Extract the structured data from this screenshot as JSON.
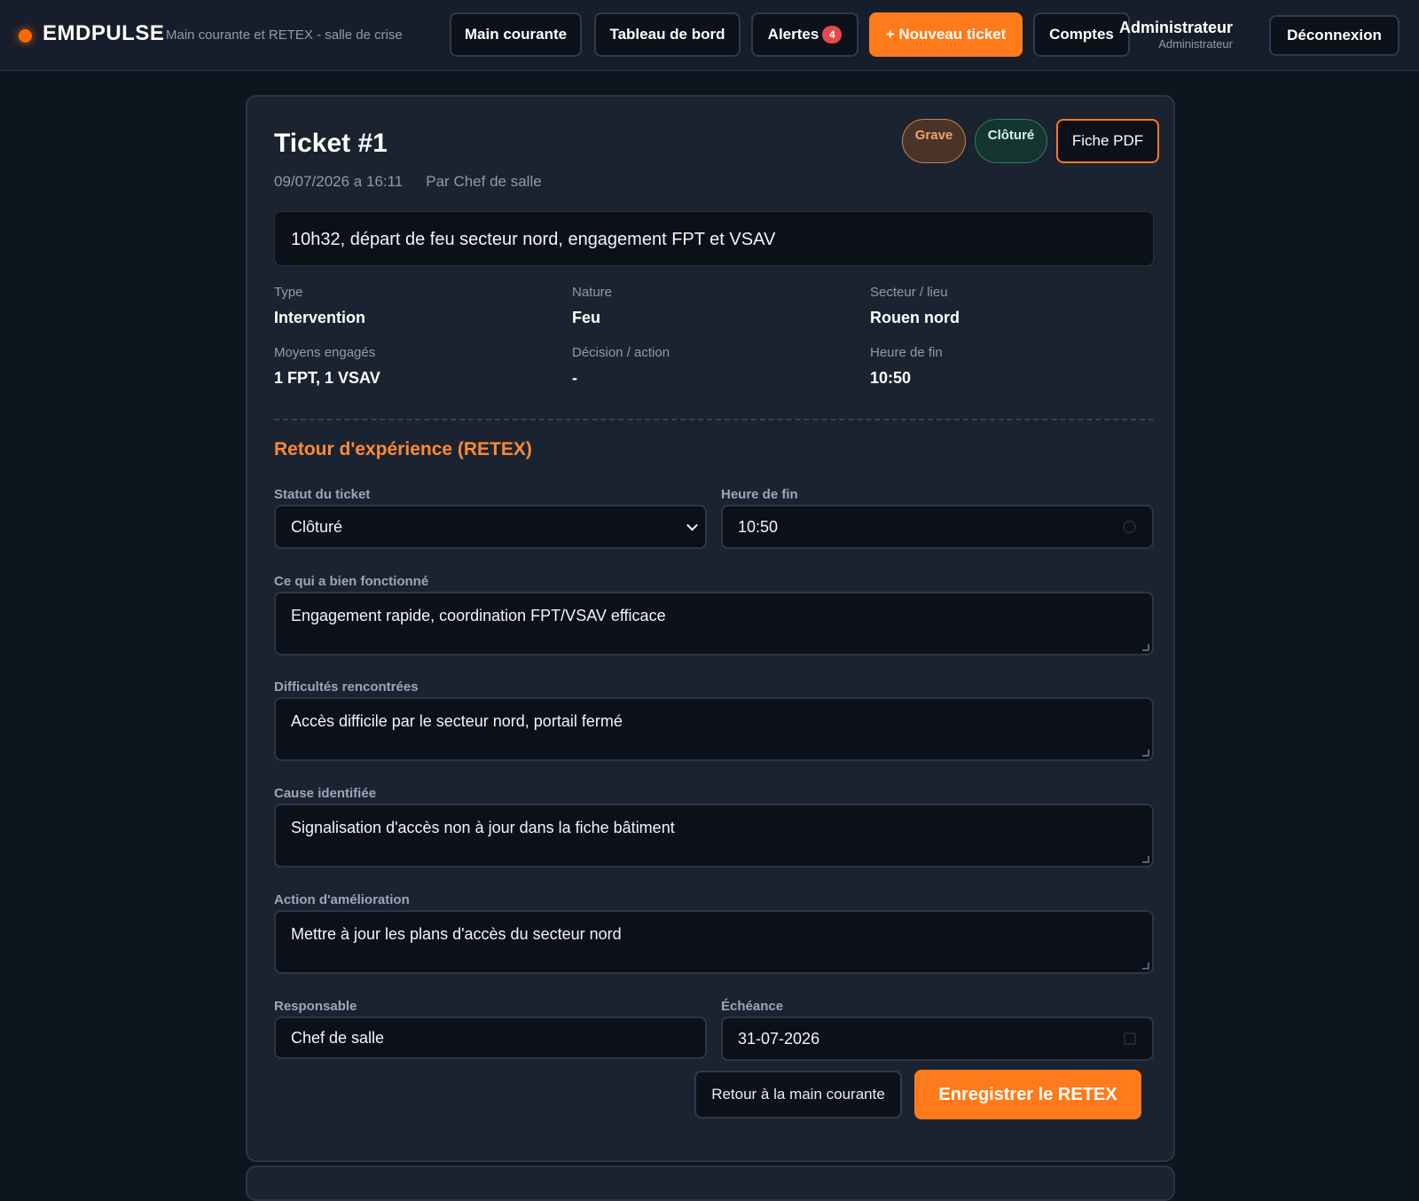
{
  "header": {
    "brand": "EMDPULSE",
    "tagline": "Main courante et RETEX - salle de crise",
    "nav": {
      "main_courante": "Main courante",
      "tableau_de_bord": "Tableau de bord",
      "alertes": "Alertes",
      "alertes_count": "4",
      "nouveau_ticket": "+ Nouveau ticket",
      "comptes": "Comptes"
    },
    "user": {
      "name": "Administrateur",
      "role": "Administrateur"
    },
    "logout": "Déconnexion"
  },
  "ticket": {
    "title": "Ticket #1",
    "datetime": "09/07/2026 a 16:11",
    "author": "Par Chef de salle",
    "severity_badge": "Grave",
    "status_badge": "Clôturé",
    "pdf_button": "Fiche PDF",
    "summary": "10h32, départ de feu secteur nord, engagement FPT et VSAV",
    "info": [
      {
        "label": "Type",
        "value": "Intervention"
      },
      {
        "label": "Nature",
        "value": "Feu"
      },
      {
        "label": "Secteur / lieu",
        "value": "Rouen nord"
      },
      {
        "label": "Moyens engagés",
        "value": "1 FPT, 1 VSAV"
      },
      {
        "label": "Décision / action",
        "value": "-"
      },
      {
        "label": "Heure de fin",
        "value": "10:50"
      }
    ]
  },
  "retex": {
    "section_title": "Retour d'expérience (RETEX)",
    "statut": {
      "label": "Statut du ticket",
      "value": "Clôturé"
    },
    "heure_fin": {
      "label": "Heure de fin",
      "value": "10:50"
    },
    "bien_fonctionne": {
      "label": "Ce qui a bien fonctionné",
      "value": "Engagement rapide, coordination FPT/VSAV efficace"
    },
    "difficultes": {
      "label": "Difficultés rencontrées",
      "value": "Accès difficile par le secteur nord, portail fermé"
    },
    "cause": {
      "label": "Cause identifiée",
      "value": "Signalisation d'accès non à jour dans la fiche bâtiment"
    },
    "action": {
      "label": "Action d'amélioration",
      "value": "Mettre à jour les plans d'accès du secteur nord"
    },
    "responsable": {
      "label": "Responsable",
      "value": "Chef de salle"
    },
    "echeance": {
      "label": "Échéance",
      "value": "31-07-2026"
    },
    "back_button": "Retour à la main courante",
    "save_button": "Enregistrer le RETEX"
  },
  "colors": {
    "accent": "#ff7a1a",
    "background": "#0f151f",
    "card": "#1b2331",
    "badge_alert": "#e5484d"
  }
}
